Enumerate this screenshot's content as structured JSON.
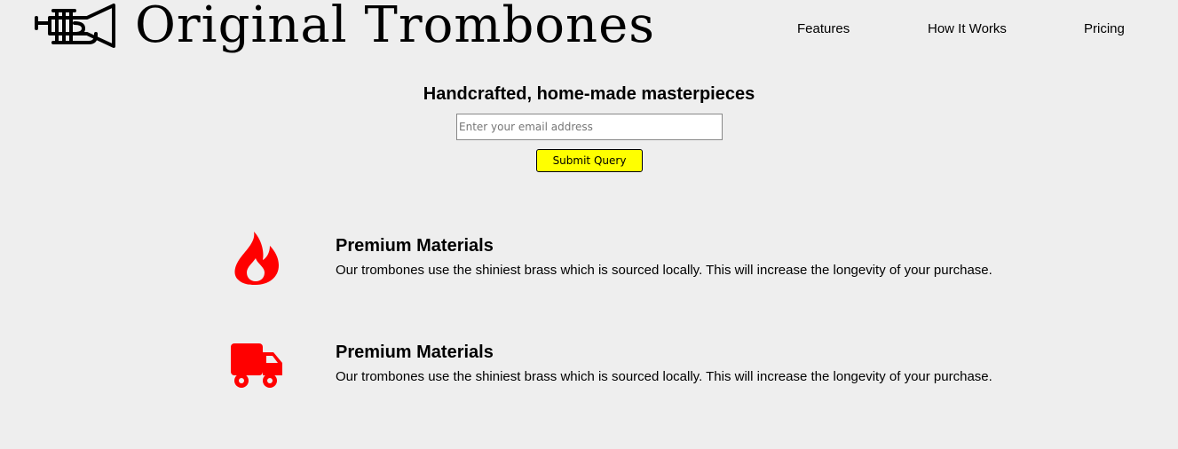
{
  "header": {
    "brand_name": "Original Trombones",
    "logo_icon": "trumpet-icon",
    "nav": [
      {
        "label": "Features"
      },
      {
        "label": "How It Works"
      },
      {
        "label": "Pricing"
      }
    ]
  },
  "hero": {
    "title": "Handcrafted, home-made masterpieces",
    "email_placeholder": "Enter your email address",
    "email_value": "",
    "submit_label": "Submit Query",
    "submit_color": "#ffff00"
  },
  "features": [
    {
      "icon": "fire-icon",
      "title": "Premium Materials",
      "description": "Our trombones use the shiniest brass which is sourced locally. This will increase the longevity of your purchase."
    },
    {
      "icon": "truck-icon",
      "title": "Premium Materials",
      "description": "Our trombones use the shiniest brass which is sourced locally. This will increase the longevity of your purchase."
    }
  ],
  "colors": {
    "background": "#eeeeee",
    "icon_accent": "#ff0000",
    "text": "#000000"
  }
}
